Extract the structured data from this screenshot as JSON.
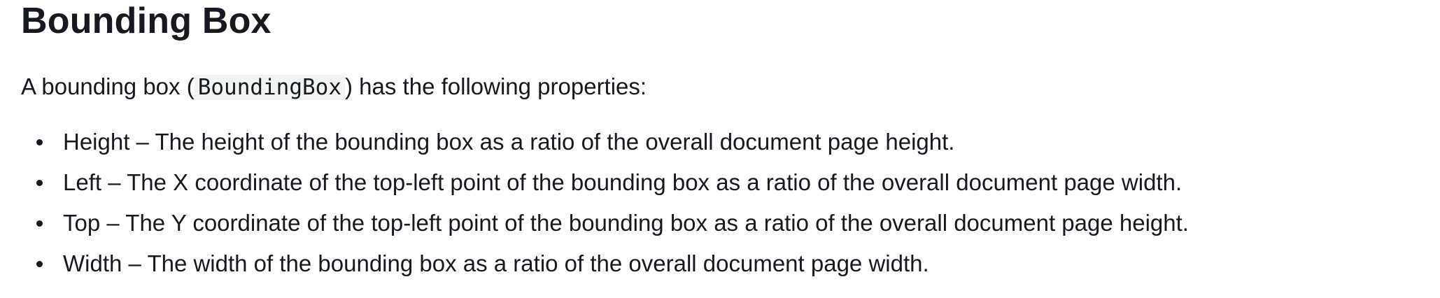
{
  "section": {
    "title": "Bounding Box",
    "intro_before": "A bounding box (",
    "intro_code": "BoundingBox",
    "intro_after": ") has the following properties:",
    "properties": [
      {
        "text": "Height – The height of the bounding box as a ratio of the overall document page height."
      },
      {
        "text": "Left – The X coordinate of the top-left point of the bounding box as a ratio of the overall document page width."
      },
      {
        "text": "Top – The Y coordinate of the top-left point of the bounding box as a ratio of the overall document page height."
      },
      {
        "text": "Width – The width of the bounding box as a ratio of the overall document page width."
      }
    ]
  }
}
